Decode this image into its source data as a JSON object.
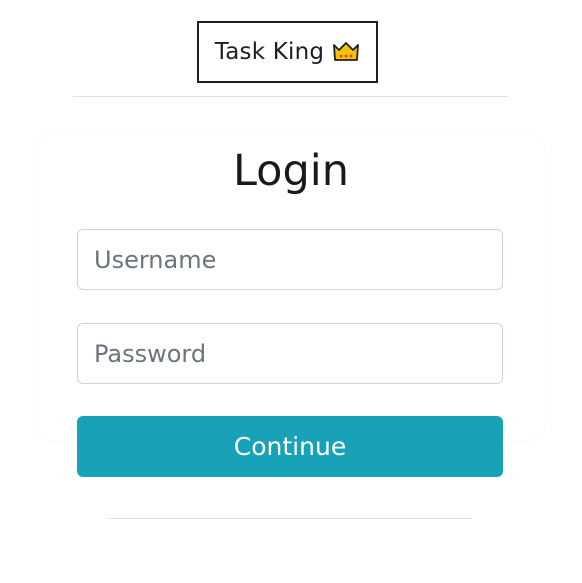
{
  "logo": {
    "text": "Task King",
    "icon": "crown-icon",
    "icon_color": "#f2c200"
  },
  "login": {
    "title": "Login",
    "username_placeholder": "Username",
    "password_placeholder": "Password",
    "username_value": "",
    "password_value": "",
    "continue_label": "Continue"
  },
  "colors": {
    "accent": "#17a2b8",
    "border": "#ced4da",
    "divider": "#dee2e6"
  }
}
